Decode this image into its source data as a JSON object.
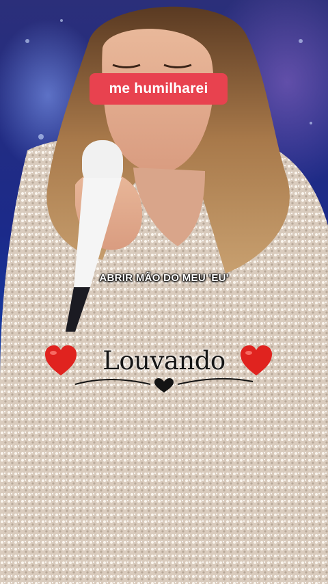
{
  "overlay": {
    "label": "me humilharei"
  },
  "caption": {
    "text": "ABRIR MÃO DO MEU 'EU'"
  },
  "brand": {
    "text": "Louvando",
    "heart_color": "#e0231f",
    "icon_left": "heart-emoji",
    "icon_right": "heart-emoji",
    "ornament": "swash-heart"
  },
  "colors": {
    "label_bg": "#e8424f",
    "stage_blue": "#1446b0",
    "sequin": "#e9ddd0"
  }
}
